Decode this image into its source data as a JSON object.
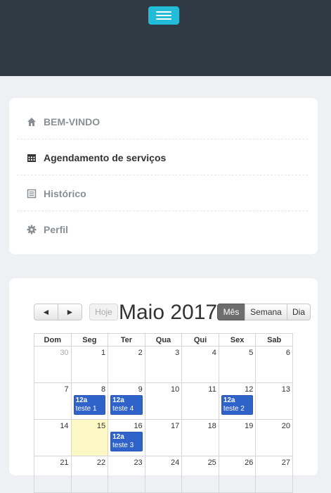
{
  "nav": {
    "items": [
      {
        "label": "BEM-VINDO",
        "icon": "home-icon"
      },
      {
        "label": "Agendamento de serviços",
        "icon": "calendar-icon"
      },
      {
        "label": "Histórico",
        "icon": "list-icon"
      },
      {
        "label": "Perfil",
        "icon": "gear-icon"
      }
    ]
  },
  "calendar": {
    "prev_label": "◄",
    "next_label": "►",
    "today_label": "Hoje",
    "title": "Maio 2017",
    "views": {
      "month": "Mês",
      "week": "Semana",
      "day": "Dia"
    },
    "weekdays": [
      "Dom",
      "Seg",
      "Ter",
      "Qua",
      "Qui",
      "Sex",
      "Sab"
    ],
    "days": [
      [
        "30",
        "1",
        "2",
        "3",
        "4",
        "5",
        "6"
      ],
      [
        "7",
        "8",
        "9",
        "10",
        "11",
        "12",
        "13"
      ],
      [
        "14",
        "15",
        "16",
        "17",
        "18",
        "19",
        "20"
      ],
      [
        "21",
        "22",
        "23",
        "24",
        "25",
        "26",
        "27"
      ]
    ],
    "events": [
      {
        "time": "12a",
        "title": "teste 1"
      },
      {
        "time": "12a",
        "title": "teste 4"
      },
      {
        "time": "12a",
        "title": "teste 2"
      },
      {
        "time": "12a",
        "title": "teste 3"
      }
    ]
  },
  "colors": {
    "topbar": "#2f3a45",
    "toggle": "#22bcd9",
    "event": "#3063c9",
    "today": "#fcf8c6"
  }
}
